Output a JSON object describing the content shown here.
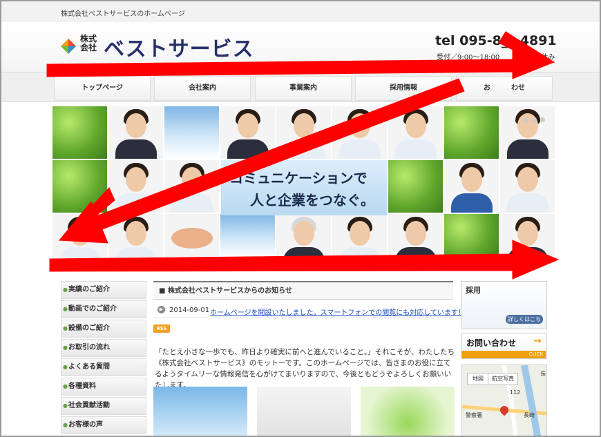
{
  "site": {
    "tagline": "株式会社ベストサービスのホームページ",
    "logo_small": "株式会社",
    "logo_name": "ベストサービス",
    "tel": "tel 095-8__-4891",
    "hours": "受付／9:00～18:00　　　　　日休み"
  },
  "nav": {
    "items": [
      {
        "label": "トップページ"
      },
      {
        "label": "会社案内"
      },
      {
        "label": "事業案内"
      },
      {
        "label": "採用情報"
      },
      {
        "label": "お　　　わせ"
      }
    ]
  },
  "hero": {
    "line1": "コミュニケーションで",
    "line2": "人と企業をつなぐ。"
  },
  "sidebar": {
    "items": [
      {
        "label": "実績のご紹介"
      },
      {
        "label": "動画でのご紹介"
      },
      {
        "label": "設備のご紹介"
      },
      {
        "label": "お取引の流れ"
      },
      {
        "label": "よくある質問"
      },
      {
        "label": "各種資料"
      },
      {
        "label": "社会貢献活動"
      },
      {
        "label": "お客様の声"
      }
    ]
  },
  "news": {
    "heading": "株式会社ベストサービスからのお知らせ",
    "items": [
      {
        "date": "2014-09-01",
        "text": "ホームページを開設いたしました。スマートフォンでの閲覧にも対応しています！"
      }
    ],
    "rss_label": "RSS"
  },
  "intro": {
    "text": "「たとえ小さな一歩でも、昨日より確実に前へと進んでいること。」それこそが、わたしたち《株式会社ベストサービス》のモットーです。このホームページでは、皆さまのお役に立てるようタイムリーな情報発信を心がけてまいりますので、今後ともどうぞよろしくお願いいたします。"
  },
  "right_column": {
    "recruit_label": "採用",
    "recruit_button": "詳しくはこちら",
    "contact_label": "お問い合わせ",
    "contact_click": "CLICK",
    "map_buttons": [
      "地図",
      "航空写真"
    ],
    "map_labels": [
      "警察署",
      "長崎",
      "112",
      "長"
    ]
  },
  "colors": {
    "logo_navy": "#27306a",
    "link_blue": "#1f4fbf",
    "accent_orange": "#f1a012",
    "annotation_red": "#ff0000"
  }
}
